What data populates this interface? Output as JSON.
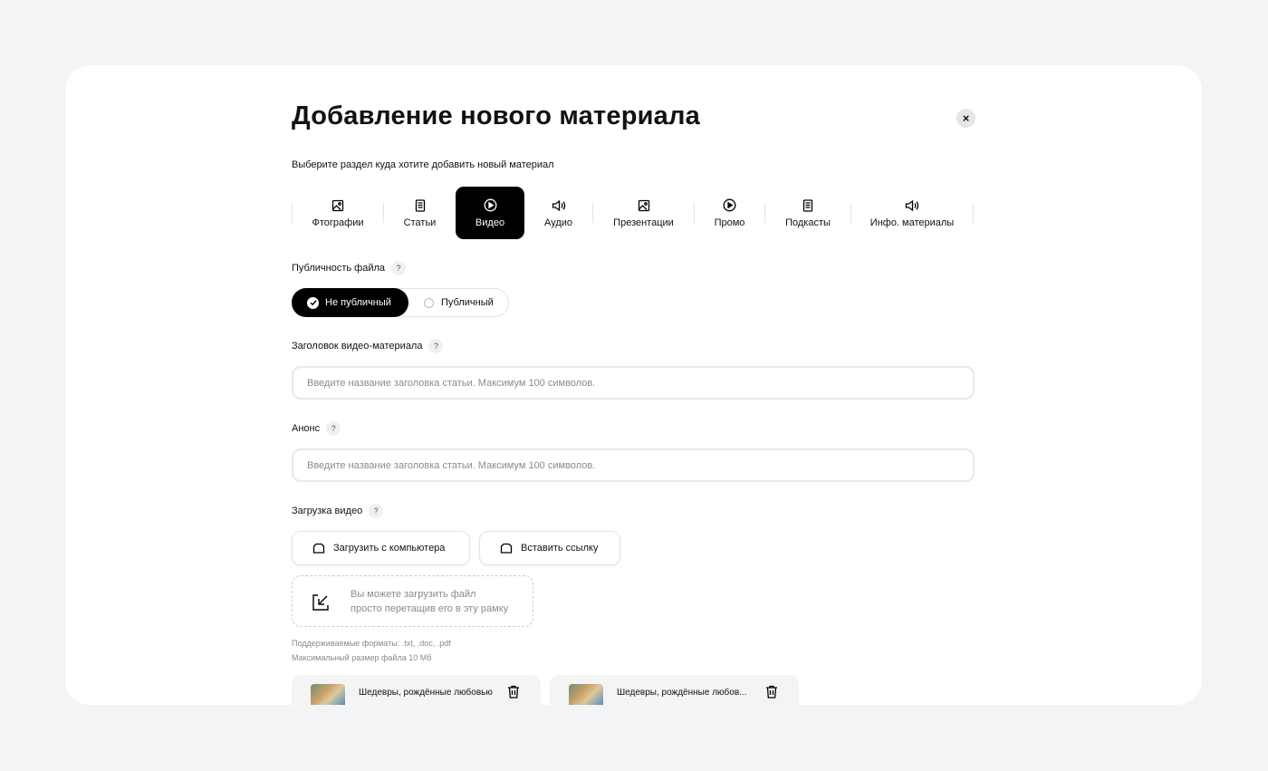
{
  "dialog": {
    "title": "Добавление нового материала",
    "close_label": "×"
  },
  "section": {
    "prompt": "Выберите раздел куда хотите добавить новый материал",
    "tabs": [
      {
        "label": "Фтографии",
        "icon": "image-icon",
        "active": false
      },
      {
        "label": "Статьи",
        "icon": "document-icon",
        "active": false
      },
      {
        "label": "Видео",
        "icon": "play-circle-icon",
        "active": true
      },
      {
        "label": "Аудио",
        "icon": "speaker-icon",
        "active": false
      },
      {
        "label": "Презентации",
        "icon": "image-icon",
        "active": false
      },
      {
        "label": "Промо",
        "icon": "play-circle-icon",
        "active": false
      },
      {
        "label": "Подкасты",
        "icon": "document-icon",
        "active": false
      },
      {
        "label": "Инфо. материалы",
        "icon": "speaker-icon",
        "active": false
      }
    ]
  },
  "publicity": {
    "label": "Публичность файла",
    "help": "?",
    "options": [
      {
        "label": "Не публичный",
        "selected": true
      },
      {
        "label": "Публичный",
        "selected": false
      }
    ]
  },
  "title_field": {
    "label": "Заголовок видео-материала",
    "help": "?",
    "placeholder": "Введите название заголовка статьи. Максимум 100 символов."
  },
  "announce_field": {
    "label": "Анонс",
    "help": "?",
    "placeholder": "Введите название заголовка статьи. Максимум 100 символов."
  },
  "upload": {
    "label": "Загрузка видео",
    "help": "?",
    "from_computer": "Загрузить с компьютера",
    "insert_link": "Вставить ссылку",
    "drop_line1": "Вы можете загрузить файл",
    "drop_line2": "просто перетащив его в эту рамку",
    "formats": "Поддерживаемые форматы: .txt, .doc, .pdf",
    "max_size": "Максимальный размер файла 10 Мб"
  },
  "files": [
    {
      "name": "Шедевры, рождённые любовью"
    },
    {
      "name": "Шедевры, рождённые любов..."
    }
  ],
  "colors": {
    "accent": "#000000",
    "page_bg": "#f3f4f6",
    "card_bg": "#ffffff",
    "muted_text": "#8a8a8a"
  }
}
